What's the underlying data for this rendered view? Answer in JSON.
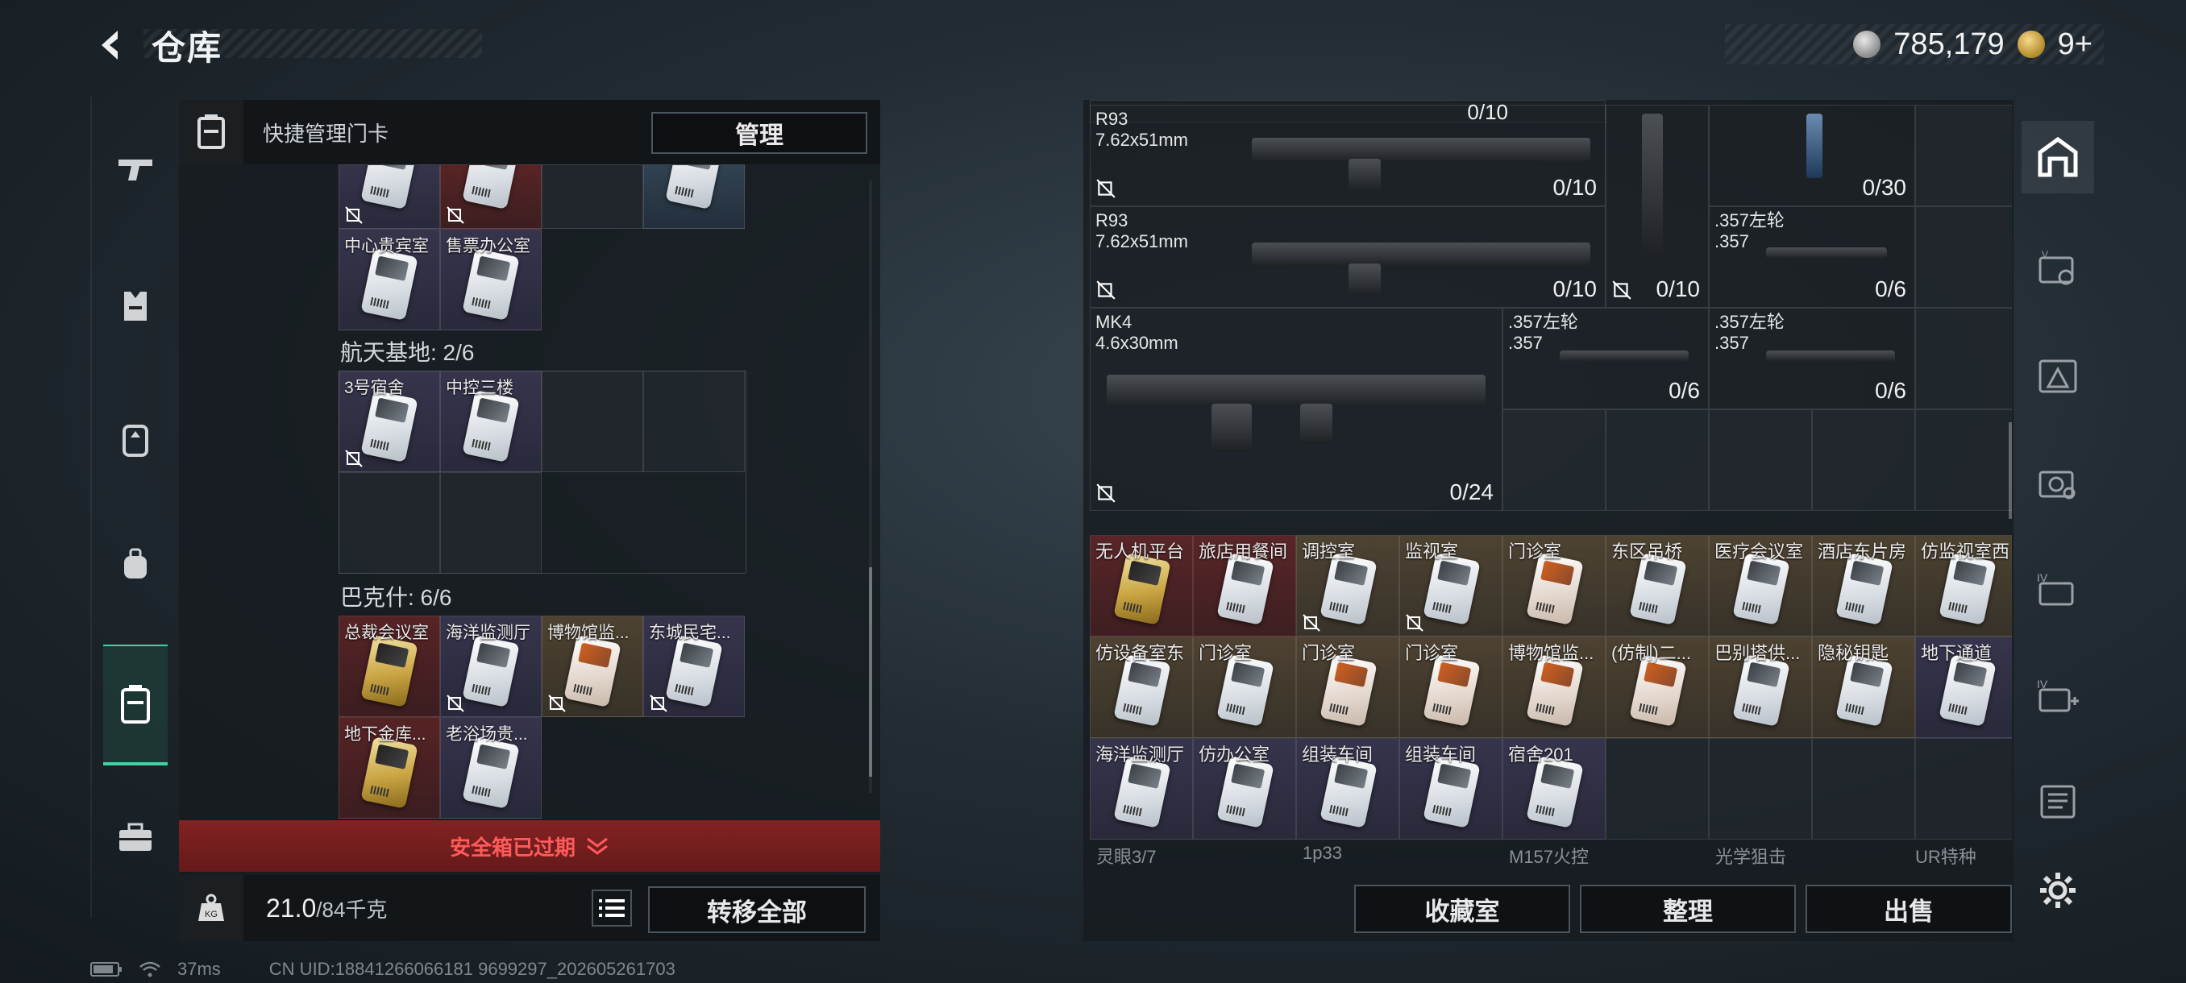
{
  "header": {
    "title": "仓库",
    "currency_primary": "785,179",
    "currency_secondary": "9+"
  },
  "left_panel": {
    "header_title": "快捷管理门卡",
    "manage_label": "管理",
    "top_row_labels": [
      "中心贵宾室",
      "售票办公室"
    ],
    "sections": [
      {
        "label": "航天基地: 2/6",
        "cards": [
          "3号宿舍",
          "中控三楼"
        ]
      },
      {
        "label": "巴克什: 6/6",
        "cards": [
          "总裁会议室",
          "海洋监测厅",
          "博物馆监...",
          "东城民宅...",
          "地下金库...",
          "老浴场贵..."
        ]
      }
    ],
    "expired_text": "安全箱已过期",
    "weight_current": "21.0",
    "weight_max": "/84千克",
    "transfer_label": "转移全部"
  },
  "right_panel": {
    "weapons": [
      {
        "name": "R93\n7.62x51mm",
        "ammo": "0/10"
      },
      {
        "name": "R93\n7.62x51mm",
        "ammo": "0/10"
      },
      {
        "name": "",
        "ammo": "0/10"
      },
      {
        "name": "",
        "ammo": "0/30"
      },
      {
        "name": ".357左轮\n.357",
        "ammo": "0/6"
      },
      {
        "name": "MK4\n4.6x30mm",
        "ammo": "0/24"
      },
      {
        "name": ".357左轮\n.357",
        "ammo": "0/6"
      },
      {
        "name": ".357左轮\n.357",
        "ammo": "0/6"
      }
    ],
    "top_partial_ammo": "0/10",
    "keycards_row1": [
      "无人机平台",
      "旅店用餐间",
      "调控室",
      "监视室",
      "门诊室",
      "东区吊桥",
      "医疗会议室",
      "酒店东片房",
      "仿监视室西"
    ],
    "keycards_row2": [
      "仿设备室东",
      "门诊室",
      "门诊室",
      "门诊室",
      "博物馆监...",
      "(仿制)二...",
      "巴别塔供...",
      "隐秘钥匙",
      "地下通道"
    ],
    "keycards_row3": [
      "海洋监测厅",
      "仿办公室",
      "组装车间",
      "组装车间",
      "宿舍201"
    ],
    "footer_categories": [
      "灵眼3/7",
      "1p33",
      "M157火控",
      "光学狙击",
      "UR特种"
    ],
    "buttons": {
      "collection": "收藏室",
      "organize": "整理",
      "sell": "出售"
    }
  },
  "status": {
    "ping": "37ms",
    "uid": "CN UID:18841266066181 9699297_202605261703"
  }
}
